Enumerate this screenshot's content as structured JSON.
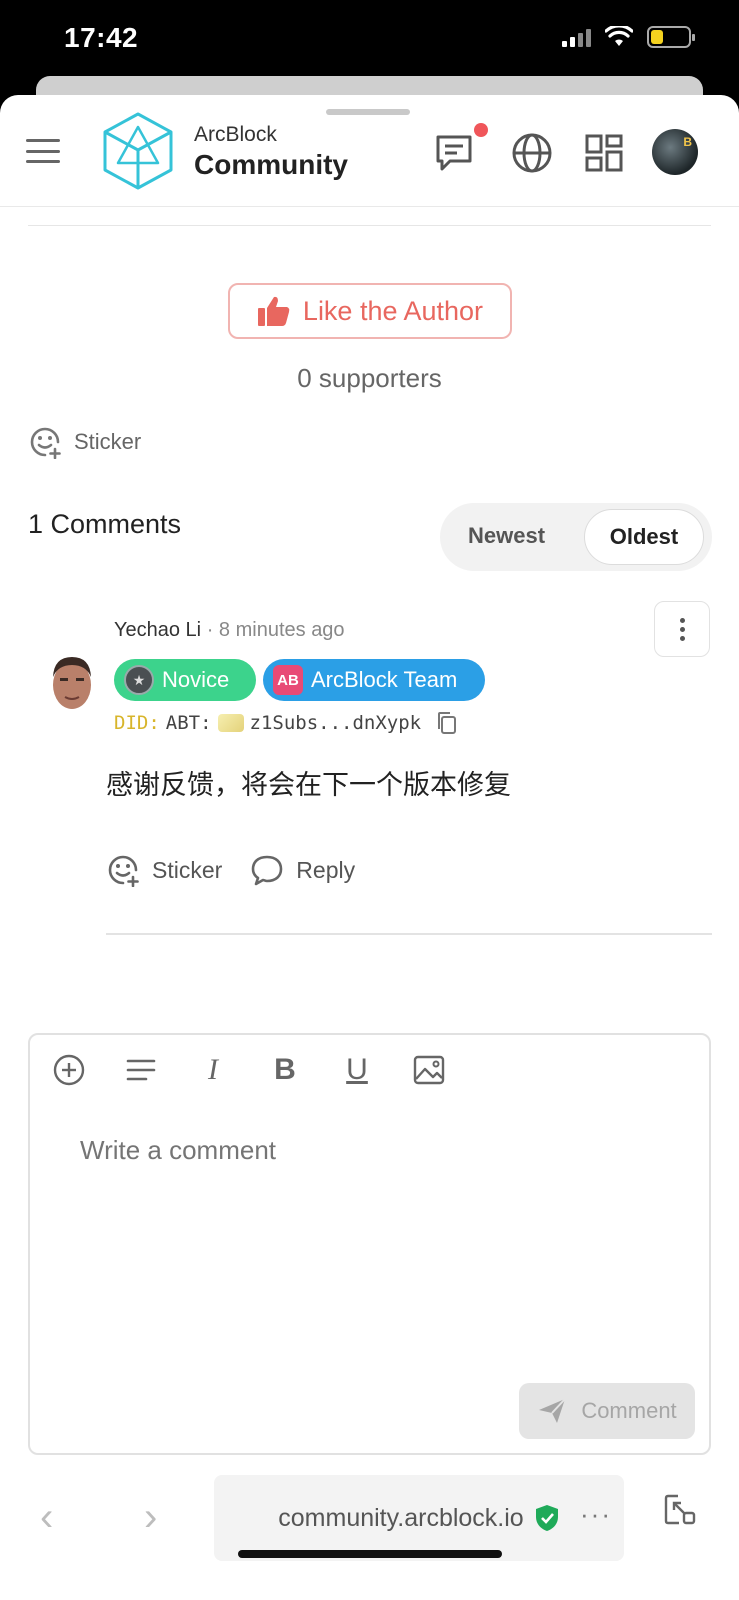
{
  "status_bar": {
    "time": "17:42"
  },
  "header": {
    "brand_top": "ArcBlock",
    "brand_bottom": "Community",
    "icons": [
      "menu-icon",
      "logo-icon",
      "chat-icon",
      "globe-icon",
      "apps-icon",
      "avatar"
    ],
    "notification_color": "#f0565a"
  },
  "like": {
    "label": "Like the Author",
    "supporters": "0 supporters",
    "accent_color": "#e8675f"
  },
  "sticker_label": "Sticker",
  "comments": {
    "title": "1 Comments",
    "sort": {
      "newest": "Newest",
      "oldest": "Oldest",
      "selected": "Oldest"
    },
    "items": [
      {
        "author": "Yechao Li",
        "separator": "·",
        "time": "8 minutes ago",
        "badges": [
          {
            "label": "Novice",
            "color": "#3cd38c"
          },
          {
            "label": "ArcBlock Team",
            "icon_text": "AB",
            "color": "#2b9fe6"
          }
        ],
        "did_prefix": "DID:",
        "did_chain": "ABT:",
        "did_value": "z1Subs...dnXypk",
        "body": "感谢反馈，将会在下一个版本修复",
        "actions": {
          "sticker": "Sticker",
          "reply": "Reply"
        }
      }
    ]
  },
  "editor": {
    "placeholder": "Write a comment",
    "submit_label": "Comment",
    "tools": [
      "add-icon",
      "paragraph-icon",
      "italic-icon",
      "bold-icon",
      "underline-icon",
      "image-icon"
    ],
    "tool_glyphs": {
      "italic": "I",
      "bold": "B",
      "underline": "U"
    }
  },
  "browser": {
    "url": "community.arcblock.io",
    "secure_color": "#1faa59",
    "more": "···"
  }
}
